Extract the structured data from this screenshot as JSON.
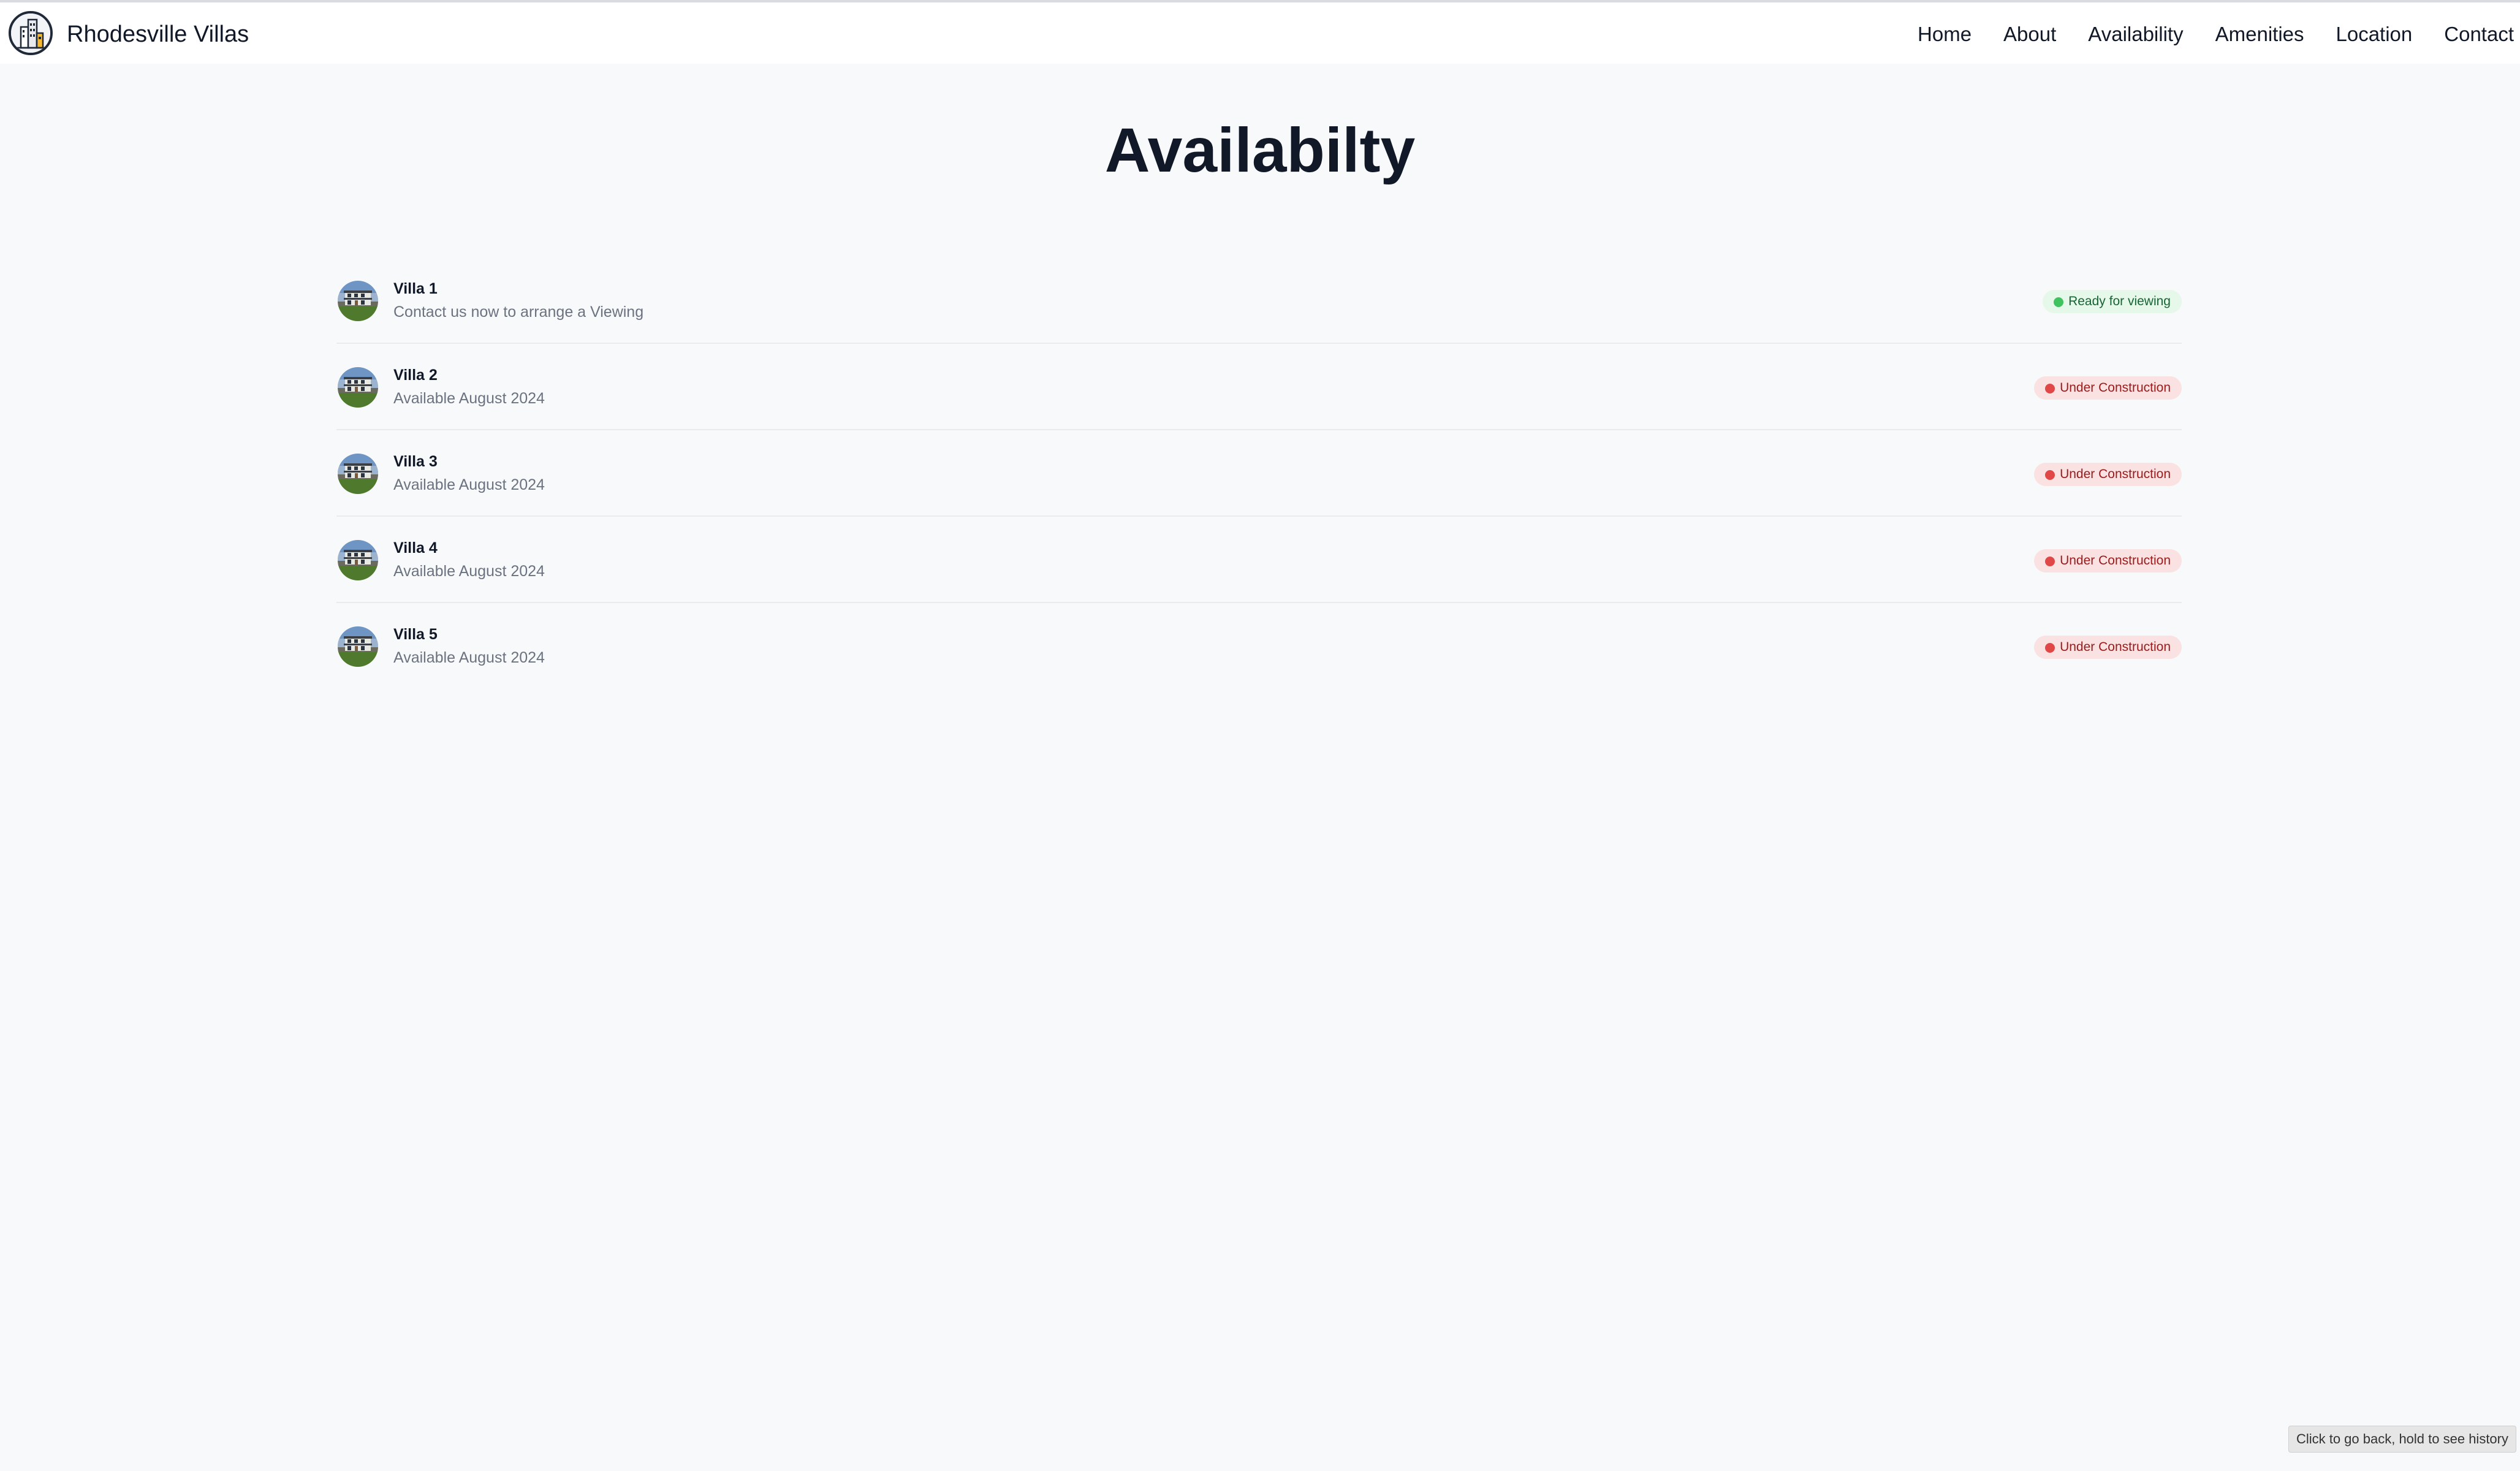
{
  "header": {
    "brand": "Rhodesville Villas",
    "logo_icon": "building-logo-icon",
    "nav": [
      {
        "label": "Home"
      },
      {
        "label": "About"
      },
      {
        "label": "Availability"
      },
      {
        "label": "Amenities"
      },
      {
        "label": "Location"
      },
      {
        "label": "Contact"
      }
    ]
  },
  "main": {
    "title": "Availabilty",
    "villas": [
      {
        "name": "Villa 1",
        "subtitle": "Contact us now to arrange a Viewing",
        "status": "Ready for viewing",
        "status_type": "ready",
        "status_color": "#3fc35f"
      },
      {
        "name": "Villa 2",
        "subtitle": "Available August 2024",
        "status": "Under Construction",
        "status_type": "construction",
        "status_color": "#e04848"
      },
      {
        "name": "Villa 3",
        "subtitle": "Available August 2024",
        "status": "Under Construction",
        "status_type": "construction",
        "status_color": "#e04848"
      },
      {
        "name": "Villa 4",
        "subtitle": "Available August 2024",
        "status": "Under Construction",
        "status_type": "construction",
        "status_color": "#e04848"
      },
      {
        "name": "Villa 5",
        "subtitle": "Available August 2024",
        "status": "Under Construction",
        "status_type": "construction",
        "status_color": "#e04848"
      }
    ]
  },
  "tooltip": {
    "text": "Click to go back, hold to see history"
  }
}
